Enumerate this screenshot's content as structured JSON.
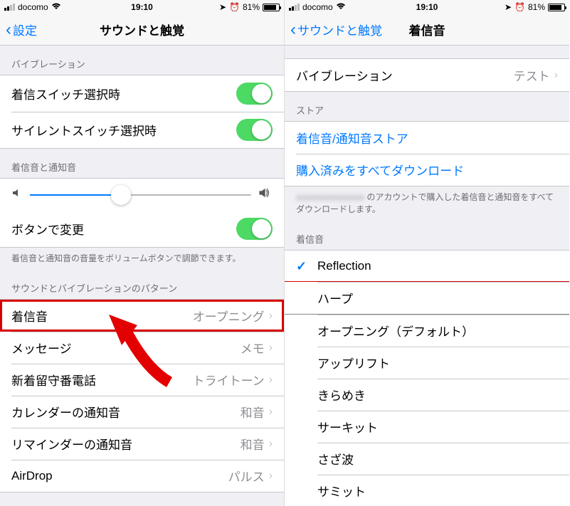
{
  "statusBar": {
    "carrier": "docomo",
    "time": "19:10",
    "battery": "81%"
  },
  "left": {
    "backLabel": "設定",
    "title": "サウンドと触覚",
    "sections": {
      "vibration": {
        "header": "バイブレーション",
        "ringSwitch": "着信スイッチ選択時",
        "silentSwitch": "サイレントスイッチ選択時"
      },
      "ringer": {
        "header": "着信音と通知音",
        "changeWithButtons": "ボタンで変更",
        "footer": "着信音と通知音の音量をボリュームボタンで調節できます。"
      },
      "patterns": {
        "header": "サウンドとバイブレーションのパターン",
        "items": [
          {
            "label": "着信音",
            "value": "オープニング"
          },
          {
            "label": "メッセージ",
            "value": "メモ"
          },
          {
            "label": "新着留守番電話",
            "value": "トライトーン"
          },
          {
            "label": "カレンダーの通知音",
            "value": "和音"
          },
          {
            "label": "リマインダーの通知音",
            "value": "和音"
          },
          {
            "label": "AirDrop",
            "value": "パルス"
          }
        ]
      }
    }
  },
  "right": {
    "backLabel": "サウンドと触覚",
    "title": "着信音",
    "vibration": {
      "label": "バイブレーション",
      "value": "テスト"
    },
    "store": {
      "header": "ストア",
      "toneStore": "着信音/通知音ストア",
      "downloadAll": "購入済みをすべてダウンロード",
      "footer": " のアカウントで購入した着信音と通知音をすべてダウンロードします。"
    },
    "ringtones": {
      "header": "着信音",
      "items": [
        {
          "label": "Reflection",
          "checked": true
        },
        {
          "label": "ハープ",
          "checked": false
        },
        {
          "label": "オープニング（デフォルト）",
          "checked": false
        },
        {
          "label": "アップリフト",
          "checked": false
        },
        {
          "label": "きらめき",
          "checked": false
        },
        {
          "label": "サーキット",
          "checked": false
        },
        {
          "label": "さざ波",
          "checked": false
        },
        {
          "label": "サミット",
          "checked": false
        }
      ]
    }
  }
}
